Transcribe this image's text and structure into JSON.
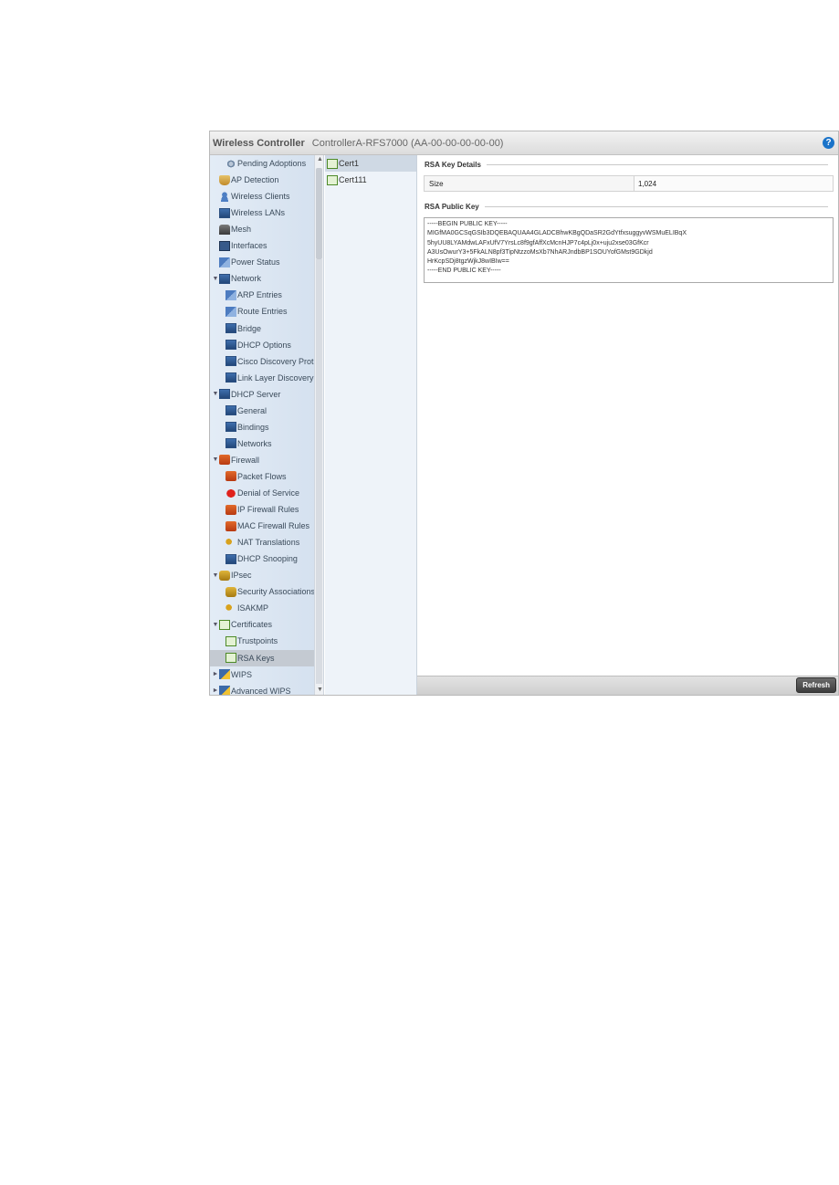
{
  "header": {
    "title": "Wireless Controller",
    "device": "ControllerA-RFS7000 (AA-00-00-00-00-00)",
    "help_icon": "?"
  },
  "sidebar": {
    "items": [
      {
        "label": "Pending Adoptions",
        "icon": "gear-icon",
        "indent": 1,
        "tri": ""
      },
      {
        "label": "AP Detection",
        "icon": "ap-icon",
        "indent": 0,
        "tri": ""
      },
      {
        "label": "Wireless Clients",
        "icon": "person-icon",
        "indent": 0,
        "tri": ""
      },
      {
        "label": "Wireless LANs",
        "icon": "network-icon",
        "indent": 0,
        "tri": ""
      },
      {
        "label": "Mesh",
        "icon": "mesh-icon",
        "indent": 0,
        "tri": ""
      },
      {
        "label": "Interfaces",
        "icon": "monitor-icon",
        "indent": 0,
        "tri": ""
      },
      {
        "label": "Power Status",
        "icon": "stats-icon",
        "indent": 0,
        "tri": ""
      },
      {
        "label": "Network",
        "icon": "network-icon",
        "indent": 0,
        "tri": "▼"
      },
      {
        "label": "ARP Entries",
        "icon": "stats-icon",
        "indent": 1,
        "tri": ""
      },
      {
        "label": "Route Entries",
        "icon": "stats-icon",
        "indent": 1,
        "tri": ""
      },
      {
        "label": "Bridge",
        "icon": "network-icon",
        "indent": 1,
        "tri": ""
      },
      {
        "label": "DHCP Options",
        "icon": "network-icon",
        "indent": 1,
        "tri": ""
      },
      {
        "label": "Cisco Discovery Prot",
        "icon": "network-icon",
        "indent": 1,
        "tri": ""
      },
      {
        "label": "Link Layer Discovery",
        "icon": "network-icon",
        "indent": 1,
        "tri": ""
      },
      {
        "label": "DHCP Server",
        "icon": "network-icon",
        "indent": 0,
        "tri": "▼"
      },
      {
        "label": "General",
        "icon": "network-icon",
        "indent": 1,
        "tri": ""
      },
      {
        "label": "Bindings",
        "icon": "network-icon",
        "indent": 1,
        "tri": ""
      },
      {
        "label": "Networks",
        "icon": "network-icon",
        "indent": 1,
        "tri": ""
      },
      {
        "label": "Firewall",
        "icon": "firewall-icon",
        "indent": 0,
        "tri": "▼"
      },
      {
        "label": "Packet Flows",
        "icon": "firewall-icon",
        "indent": 1,
        "tri": ""
      },
      {
        "label": "Denial of Service",
        "icon": "deny-icon",
        "indent": 1,
        "tri": ""
      },
      {
        "label": "IP Firewall Rules",
        "icon": "firewall-icon",
        "indent": 1,
        "tri": ""
      },
      {
        "label": "MAC Firewall Rules",
        "icon": "firewall-icon",
        "indent": 1,
        "tri": ""
      },
      {
        "label": "NAT Translations",
        "icon": "key-icon",
        "indent": 1,
        "tri": ""
      },
      {
        "label": "DHCP Snooping",
        "icon": "network-icon",
        "indent": 1,
        "tri": ""
      },
      {
        "label": "IPsec",
        "icon": "lock-icon",
        "indent": 0,
        "tri": "▼"
      },
      {
        "label": "Security Associations",
        "icon": "lock-icon",
        "indent": 1,
        "tri": ""
      },
      {
        "label": "ISAKMP",
        "icon": "key-icon",
        "indent": 1,
        "tri": ""
      },
      {
        "label": "Certificates",
        "icon": "certificate-icon",
        "indent": 0,
        "tri": "▼"
      },
      {
        "label": "Trustpoints",
        "icon": "certificate-icon",
        "indent": 1,
        "tri": ""
      },
      {
        "label": "RSA Keys",
        "icon": "certificate-icon",
        "indent": 1,
        "tri": "",
        "selected": true
      },
      {
        "label": "WIPS",
        "icon": "wips-icon",
        "indent": 0,
        "tri": "►"
      },
      {
        "label": "Advanced WIPS",
        "icon": "wips-icon",
        "indent": 0,
        "tri": "►"
      }
    ]
  },
  "cert_list": [
    {
      "label": "Cert1",
      "selected": true
    },
    {
      "label": "Cert111",
      "selected": false
    }
  ],
  "details": {
    "rsa_key_details_title": "RSA Key Details",
    "size_label": "Size",
    "size_value": "1,024",
    "rsa_public_key_title": "RSA Public Key",
    "public_key_lines": [
      "-----BEGIN PUBLIC KEY-----",
      "MIGfMA0GCSqGSIb3DQEBAQUAA4GLADCBhwKBgQDaSR2GdYtfxsuggyvWSMuELIBqX",
      "5hyUU8LYAMdwLAFxUfV7YrsLc8f9gfAffXcMcnHJP7c4pLj0x+uju2xse03GfKcr",
      "A3UsOwurY3+5FkALN8pf3TipNtzzoMsXb7NhARJndbBP1SOUYofGMst9GDkjd",
      "HrKcpSDj8tgzWjkJ8wIBIw==",
      "-----END PUBLIC KEY-----"
    ]
  },
  "footer": {
    "refresh_label": "Refresh"
  }
}
